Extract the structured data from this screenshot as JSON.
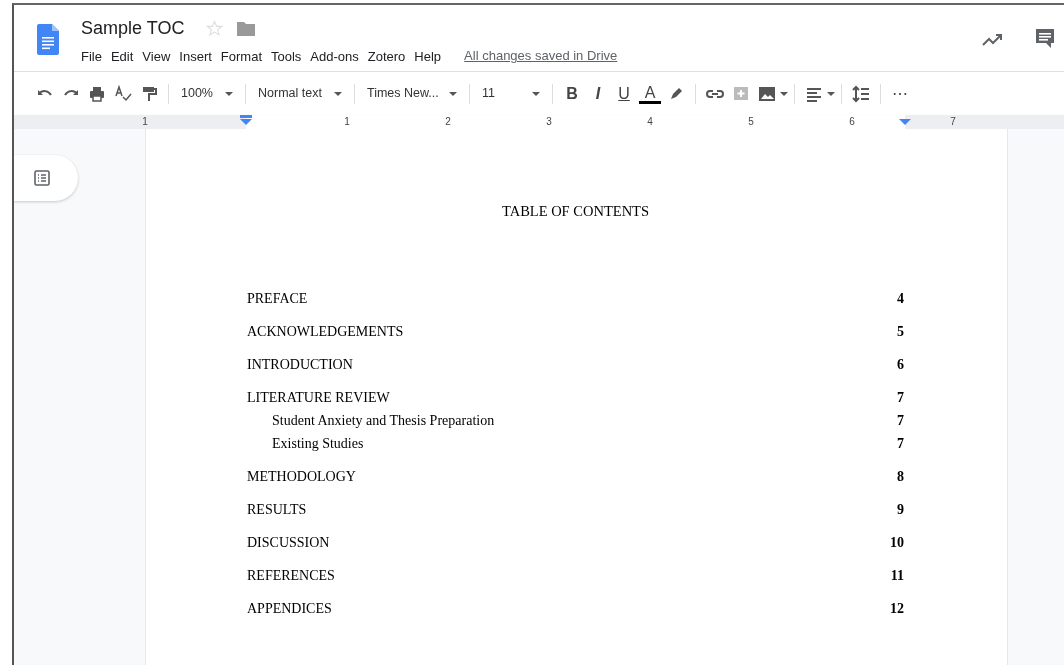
{
  "document": {
    "title": "Sample TOC",
    "starred": false
  },
  "menu": [
    "File",
    "Edit",
    "View",
    "Insert",
    "Format",
    "Tools",
    "Add-ons",
    "Zotero",
    "Help"
  ],
  "save_status": "All changes saved in Drive",
  "toolbar": {
    "zoom": "100%",
    "style": "Normal text",
    "font": "Times New...",
    "font_size": "11",
    "bold": "B",
    "italic": "I",
    "underline": "U",
    "text_color_label": "A",
    "more": "⋯"
  },
  "ruler": {
    "labels": [
      "1",
      "1",
      "2",
      "3",
      "4",
      "5",
      "6",
      "7"
    ]
  },
  "toc": {
    "heading": "TABLE OF CONTENTS",
    "entries": [
      {
        "title": "PREFACE",
        "page": "4"
      },
      {
        "title": "ACKNOWLEDGEMENTS",
        "page": "5"
      },
      {
        "title": "INTRODUCTION",
        "page": "6"
      },
      {
        "title": "LITERATURE REVIEW",
        "page": "7",
        "children": [
          {
            "title": "Student Anxiety and Thesis Preparation",
            "page": "7"
          },
          {
            "title": "Existing Studies",
            "page": "7"
          }
        ]
      },
      {
        "title": "METHODOLOGY",
        "page": "8"
      },
      {
        "title": "RESULTS",
        "page": "9"
      },
      {
        "title": "DISCUSSION",
        "page": "10"
      },
      {
        "title": "REFERENCES",
        "page": "11"
      },
      {
        "title": "APPENDICES",
        "page": "12"
      }
    ]
  }
}
